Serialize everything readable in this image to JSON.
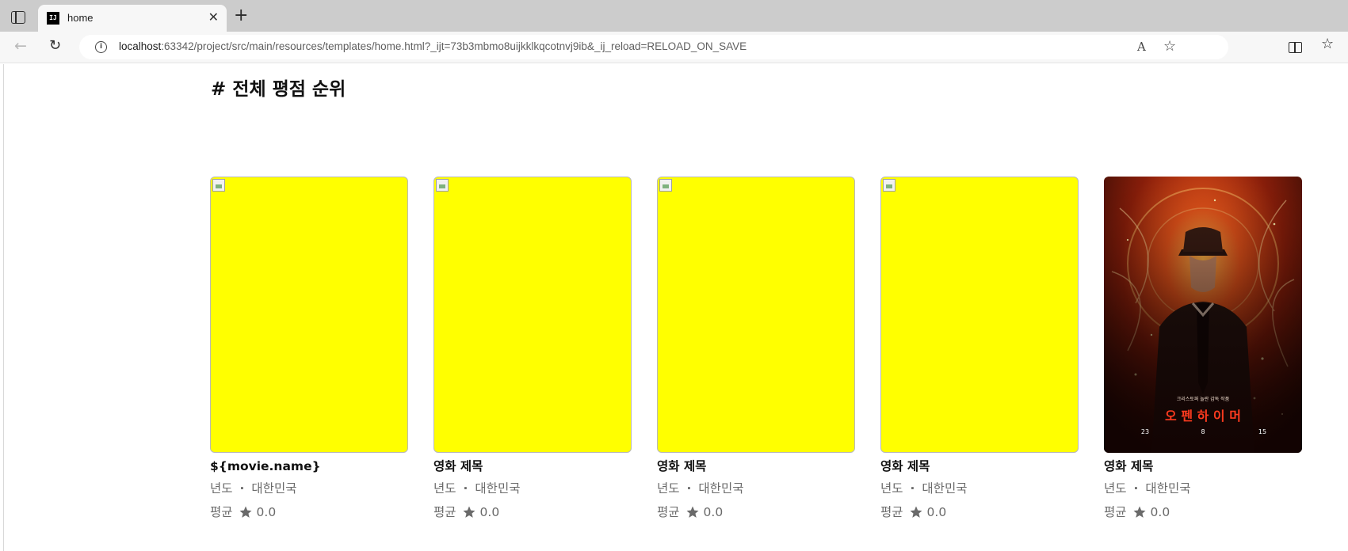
{
  "browser": {
    "tab_title": "home",
    "favicon_text": "IJ",
    "url_host": "localhost",
    "url_rest": ":63342/project/src/main/resources/templates/home.html?_ijt=73b3mbmo8uijkklkqcotnvj9ib&_ij_reload=RELOAD_ON_SAVE",
    "read_aloud_glyph": "A"
  },
  "page": {
    "section_title": "# 전체 평점 순위",
    "movies": [
      {
        "title": "${movie.name}",
        "year_label": "년도",
        "country": "대한민국",
        "avg_label": "평균",
        "rating": "0.0",
        "poster": "broken-image-yellow"
      },
      {
        "title": "영화 제목",
        "year_label": "년도",
        "country": "대한민국",
        "avg_label": "평균",
        "rating": "0.0",
        "poster": "broken-image-yellow"
      },
      {
        "title": "영화 제목",
        "year_label": "년도",
        "country": "대한민국",
        "avg_label": "평균",
        "rating": "0.0",
        "poster": "broken-image-yellow"
      },
      {
        "title": "영화 제목",
        "year_label": "년도",
        "country": "대한민국",
        "avg_label": "평균",
        "rating": "0.0",
        "poster": "broken-image-yellow"
      },
      {
        "title": "영화 제목",
        "year_label": "년도",
        "country": "대한민국",
        "avg_label": "평균",
        "rating": "0.0",
        "poster": "oppenheimer"
      }
    ],
    "oppenheimer_poster": {
      "tagline": "크리스토퍼 놀란 감독 작품",
      "title": "오 펜 하 이 머",
      "date_parts": [
        "23",
        "8",
        "15"
      ]
    }
  },
  "colors": {
    "placeholder_poster": "#ffff00",
    "meta_text": "#6a6a6a",
    "poster_title_red": "#ff3b1f"
  }
}
